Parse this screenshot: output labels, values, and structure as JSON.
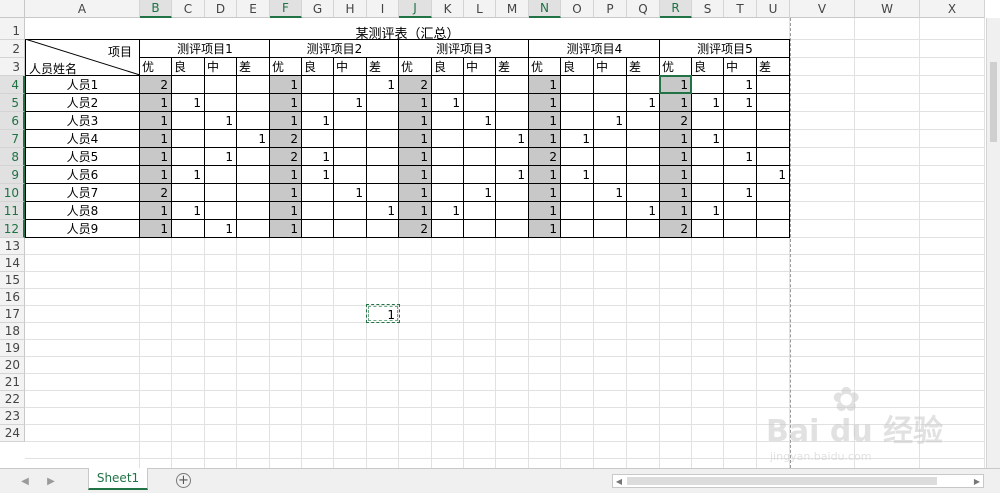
{
  "columns": [
    "A",
    "B",
    "C",
    "D",
    "E",
    "F",
    "G",
    "H",
    "I",
    "J",
    "K",
    "L",
    "M",
    "N",
    "O",
    "P",
    "Q",
    "R",
    "S",
    "T",
    "U",
    "V",
    "W",
    "X"
  ],
  "selected_columns": [
    "B",
    "F",
    "J",
    "N",
    "R"
  ],
  "rows": [
    "1",
    "2",
    "3",
    "4",
    "5",
    "6",
    "7",
    "8",
    "9",
    "10",
    "11",
    "12",
    "13",
    "14",
    "15",
    "16",
    "17",
    "18",
    "19",
    "20",
    "21",
    "22",
    "23",
    "24"
  ],
  "selected_rows": [
    "4",
    "5",
    "6",
    "7",
    "8",
    "9",
    "10",
    "11",
    "12"
  ],
  "sheet": {
    "title": "某测评表（汇总）",
    "corner_top": "项目",
    "corner_bottom": "人员姓名",
    "groups": [
      "测评项目1",
      "测评项目2",
      "测评项目3",
      "测评项目4",
      "测评项目5"
    ],
    "grades": [
      "优",
      "良",
      "中",
      "差"
    ],
    "people": [
      "人员1",
      "人员2",
      "人员3",
      "人员4",
      "人员5",
      "人员6",
      "人员7",
      "人员8",
      "人员9"
    ],
    "values": [
      [
        "2",
        "",
        "",
        "",
        "1",
        "",
        "",
        "1",
        "2",
        "",
        "",
        "",
        "1",
        "",
        "",
        "",
        "1",
        "",
        "1",
        ""
      ],
      [
        "1",
        "1",
        "",
        "",
        "1",
        "",
        "1",
        "",
        "1",
        "1",
        "",
        "",
        "1",
        "",
        "",
        "1",
        "1",
        "1",
        "1",
        ""
      ],
      [
        "1",
        "",
        "1",
        "",
        "1",
        "1",
        "",
        "",
        "1",
        "",
        "1",
        "",
        "1",
        "",
        "1",
        "",
        "2",
        "",
        "",
        ""
      ],
      [
        "1",
        "",
        "",
        "1",
        "2",
        "",
        "",
        "",
        "1",
        "",
        "",
        "1",
        "1",
        "1",
        "",
        "",
        "1",
        "1",
        "",
        ""
      ],
      [
        "1",
        "",
        "1",
        "",
        "2",
        "1",
        "",
        "",
        "1",
        "",
        "",
        "",
        "2",
        "",
        "",
        "",
        "1",
        "",
        "1",
        ""
      ],
      [
        "1",
        "1",
        "",
        "",
        "1",
        "1",
        "",
        "",
        "1",
        "",
        "",
        "1",
        "1",
        "1",
        "",
        "",
        "1",
        "",
        "",
        "1"
      ],
      [
        "2",
        "",
        "",
        "",
        "1",
        "",
        "1",
        "",
        "1",
        "",
        "1",
        "",
        "1",
        "",
        "1",
        "",
        "1",
        "",
        "1",
        ""
      ],
      [
        "1",
        "1",
        "",
        "",
        "1",
        "",
        "",
        "1",
        "1",
        "1",
        "",
        "",
        "1",
        "",
        "",
        "1",
        "1",
        "1",
        "",
        ""
      ],
      [
        "1",
        "",
        "1",
        "",
        "1",
        "",
        "",
        "",
        "2",
        "",
        "",
        "",
        "1",
        "",
        "",
        "",
        "2",
        "",
        "",
        ""
      ]
    ],
    "floating_cell_value": "1"
  },
  "tabs": {
    "active": "Sheet1",
    "add_label": "+"
  },
  "nav": {
    "prev": "◀",
    "next": "▶"
  },
  "colors": {
    "selected_fill": "#c8c8c8",
    "accent": "#217346"
  }
}
